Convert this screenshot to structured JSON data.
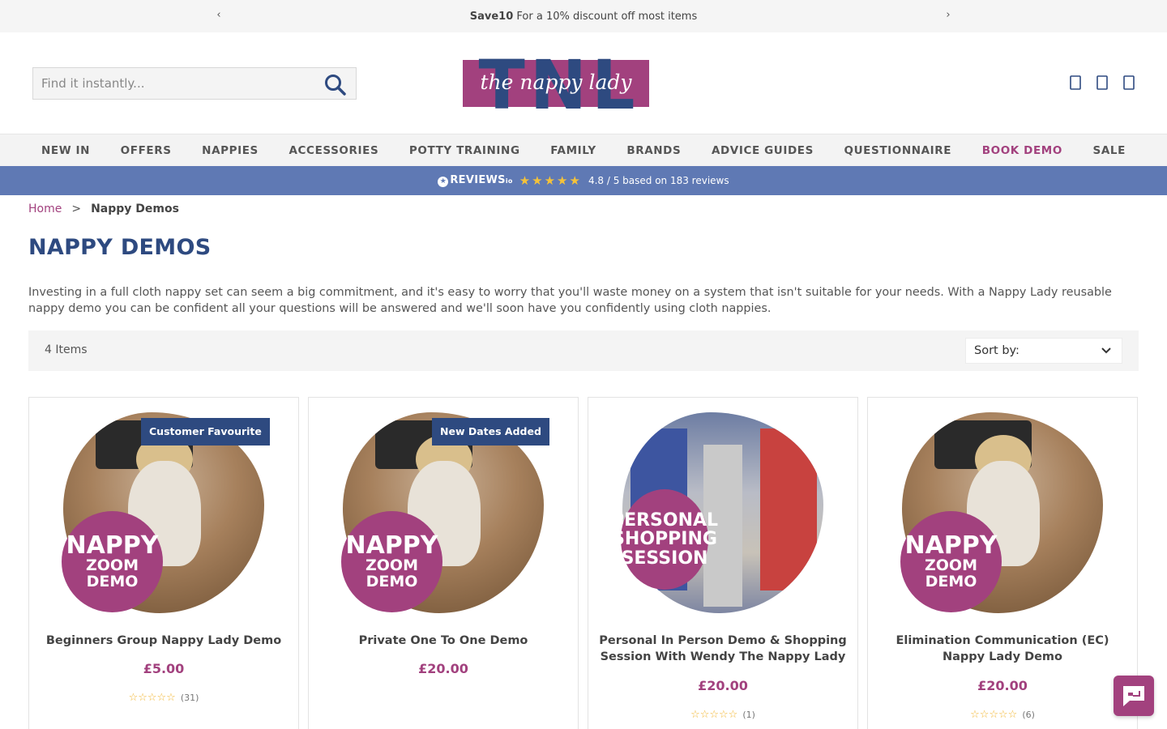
{
  "promo": {
    "prev_icon": "chevron-left-icon",
    "next_icon": "chevron-right-icon",
    "code": "Save10",
    "text": "For a 10% discount off most items"
  },
  "header": {
    "search_placeholder": "Find it instantly...",
    "search_icon": "search-icon",
    "logo_letters": "TNL",
    "logo_script": "the nappy lady",
    "icons": [
      "account-icon",
      "wishlist-icon",
      "basket-icon"
    ]
  },
  "nav": {
    "items": [
      {
        "label": "NEW IN"
      },
      {
        "label": "OFFERS"
      },
      {
        "label": "NAPPIES"
      },
      {
        "label": "ACCESSORIES"
      },
      {
        "label": "POTTY TRAINING"
      },
      {
        "label": "FAMILY"
      },
      {
        "label": "BRANDS"
      },
      {
        "label": "ADVICE GUIDES"
      },
      {
        "label": "QUESTIONNAIRE"
      },
      {
        "label": "BOOK DEMO"
      },
      {
        "label": "SALE"
      }
    ],
    "highlight_color": "#a2417e"
  },
  "reviews": {
    "brand": "REVIEWS",
    "brand_suffix": "io",
    "stars": "★★★★★",
    "score_text": "4.8 / 5 based on 183 reviews",
    "rating": 4.8
  },
  "breadcrumb": {
    "home": "Home",
    "separator": ">",
    "current": "Nappy Demos"
  },
  "page": {
    "title": "NAPPY DEMOS",
    "intro": "Investing in a full cloth nappy set can seem a big commitment, and it's easy to worry that you'll waste money on a system that isn't suitable for your needs. With a Nappy Lady reusable nappy demo you can be confident all your questions will be answered and we'll soon have you confidently using cloth nappies."
  },
  "toolbar": {
    "item_count": "4 Items",
    "sort_label": "Sort by:",
    "sort_icon": "chevron-down-icon"
  },
  "products": [
    {
      "name": "Beginners Group Nappy Lady Demo",
      "price": "£5.00",
      "ribbon": "Customer Favourite",
      "badge_big": "NAPPY",
      "badge_small": "ZOOM DEMO",
      "stars": "☆☆☆☆☆",
      "reviews": "(31)"
    },
    {
      "name": "Private One To One Demo",
      "price": "£20.00",
      "ribbon": "New Dates Added",
      "badge_big": "NAPPY",
      "badge_small": "ZOOM DEMO"
    },
    {
      "name": "Personal In Person Demo & Shopping Session With Wendy The Nappy Lady",
      "price": "£20.00",
      "badge_big": "PERSONAL",
      "badge_small": "SHOPPING SESSION",
      "stars": "☆☆☆☆☆",
      "reviews": "(1)"
    },
    {
      "name": "Elimination Communication (EC) Nappy Lady Demo",
      "price": "£20.00",
      "badge_big": "NAPPY",
      "badge_small": "ZOOM DEMO",
      "stars": "☆☆☆☆☆",
      "reviews": "(6)"
    }
  ],
  "chat": {
    "icon": "chat-icon"
  },
  "colors": {
    "brand_navy": "#2e4a80",
    "brand_plum": "#a2417e",
    "reviews_bar": "#5f79b4"
  }
}
